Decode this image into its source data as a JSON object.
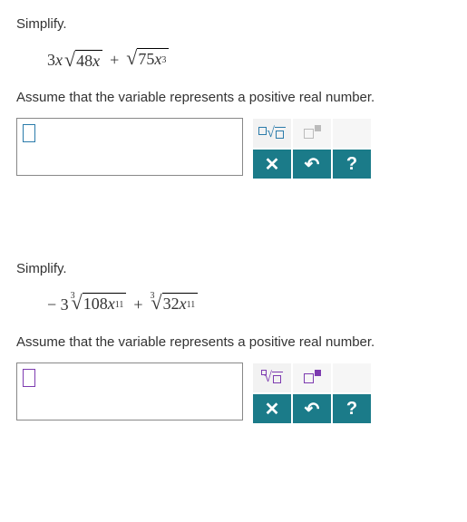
{
  "problems": [
    {
      "prompt": "Simplify.",
      "assume": "Assume that the variable represents a positive real number.",
      "accent": "#2a7baa",
      "expr": {
        "terms": [
          {
            "coef_num": "3",
            "coef_var": "x",
            "root_index": "",
            "radicand_num": "48",
            "radicand_var": "x",
            "radicand_exp": ""
          },
          {
            "op": "+",
            "coef_num": "",
            "coef_var": "",
            "root_index": "",
            "radicand_num": "75",
            "radicand_var": "x",
            "radicand_exp": "3"
          }
        ]
      }
    },
    {
      "prompt": "Simplify.",
      "assume": "Assume that the variable represents a positive real number.",
      "accent": "#7d3bb0",
      "expr": {
        "terms": [
          {
            "coef_num": "− 3",
            "coef_var": "",
            "root_index": "3",
            "radicand_num": "108",
            "radicand_var": "x",
            "radicand_exp": "11"
          },
          {
            "op": "+",
            "coef_num": "",
            "coef_var": "",
            "root_index": "3",
            "radicand_num": "32",
            "radicand_var": "x",
            "radicand_exp": "11"
          }
        ]
      }
    }
  ],
  "toolbar": {
    "sqrt_tip": "square-root",
    "nthroot_tip": "nth-root",
    "exponent_tip": "exponent",
    "clear": "✕",
    "undo": "↶",
    "help": "?"
  }
}
